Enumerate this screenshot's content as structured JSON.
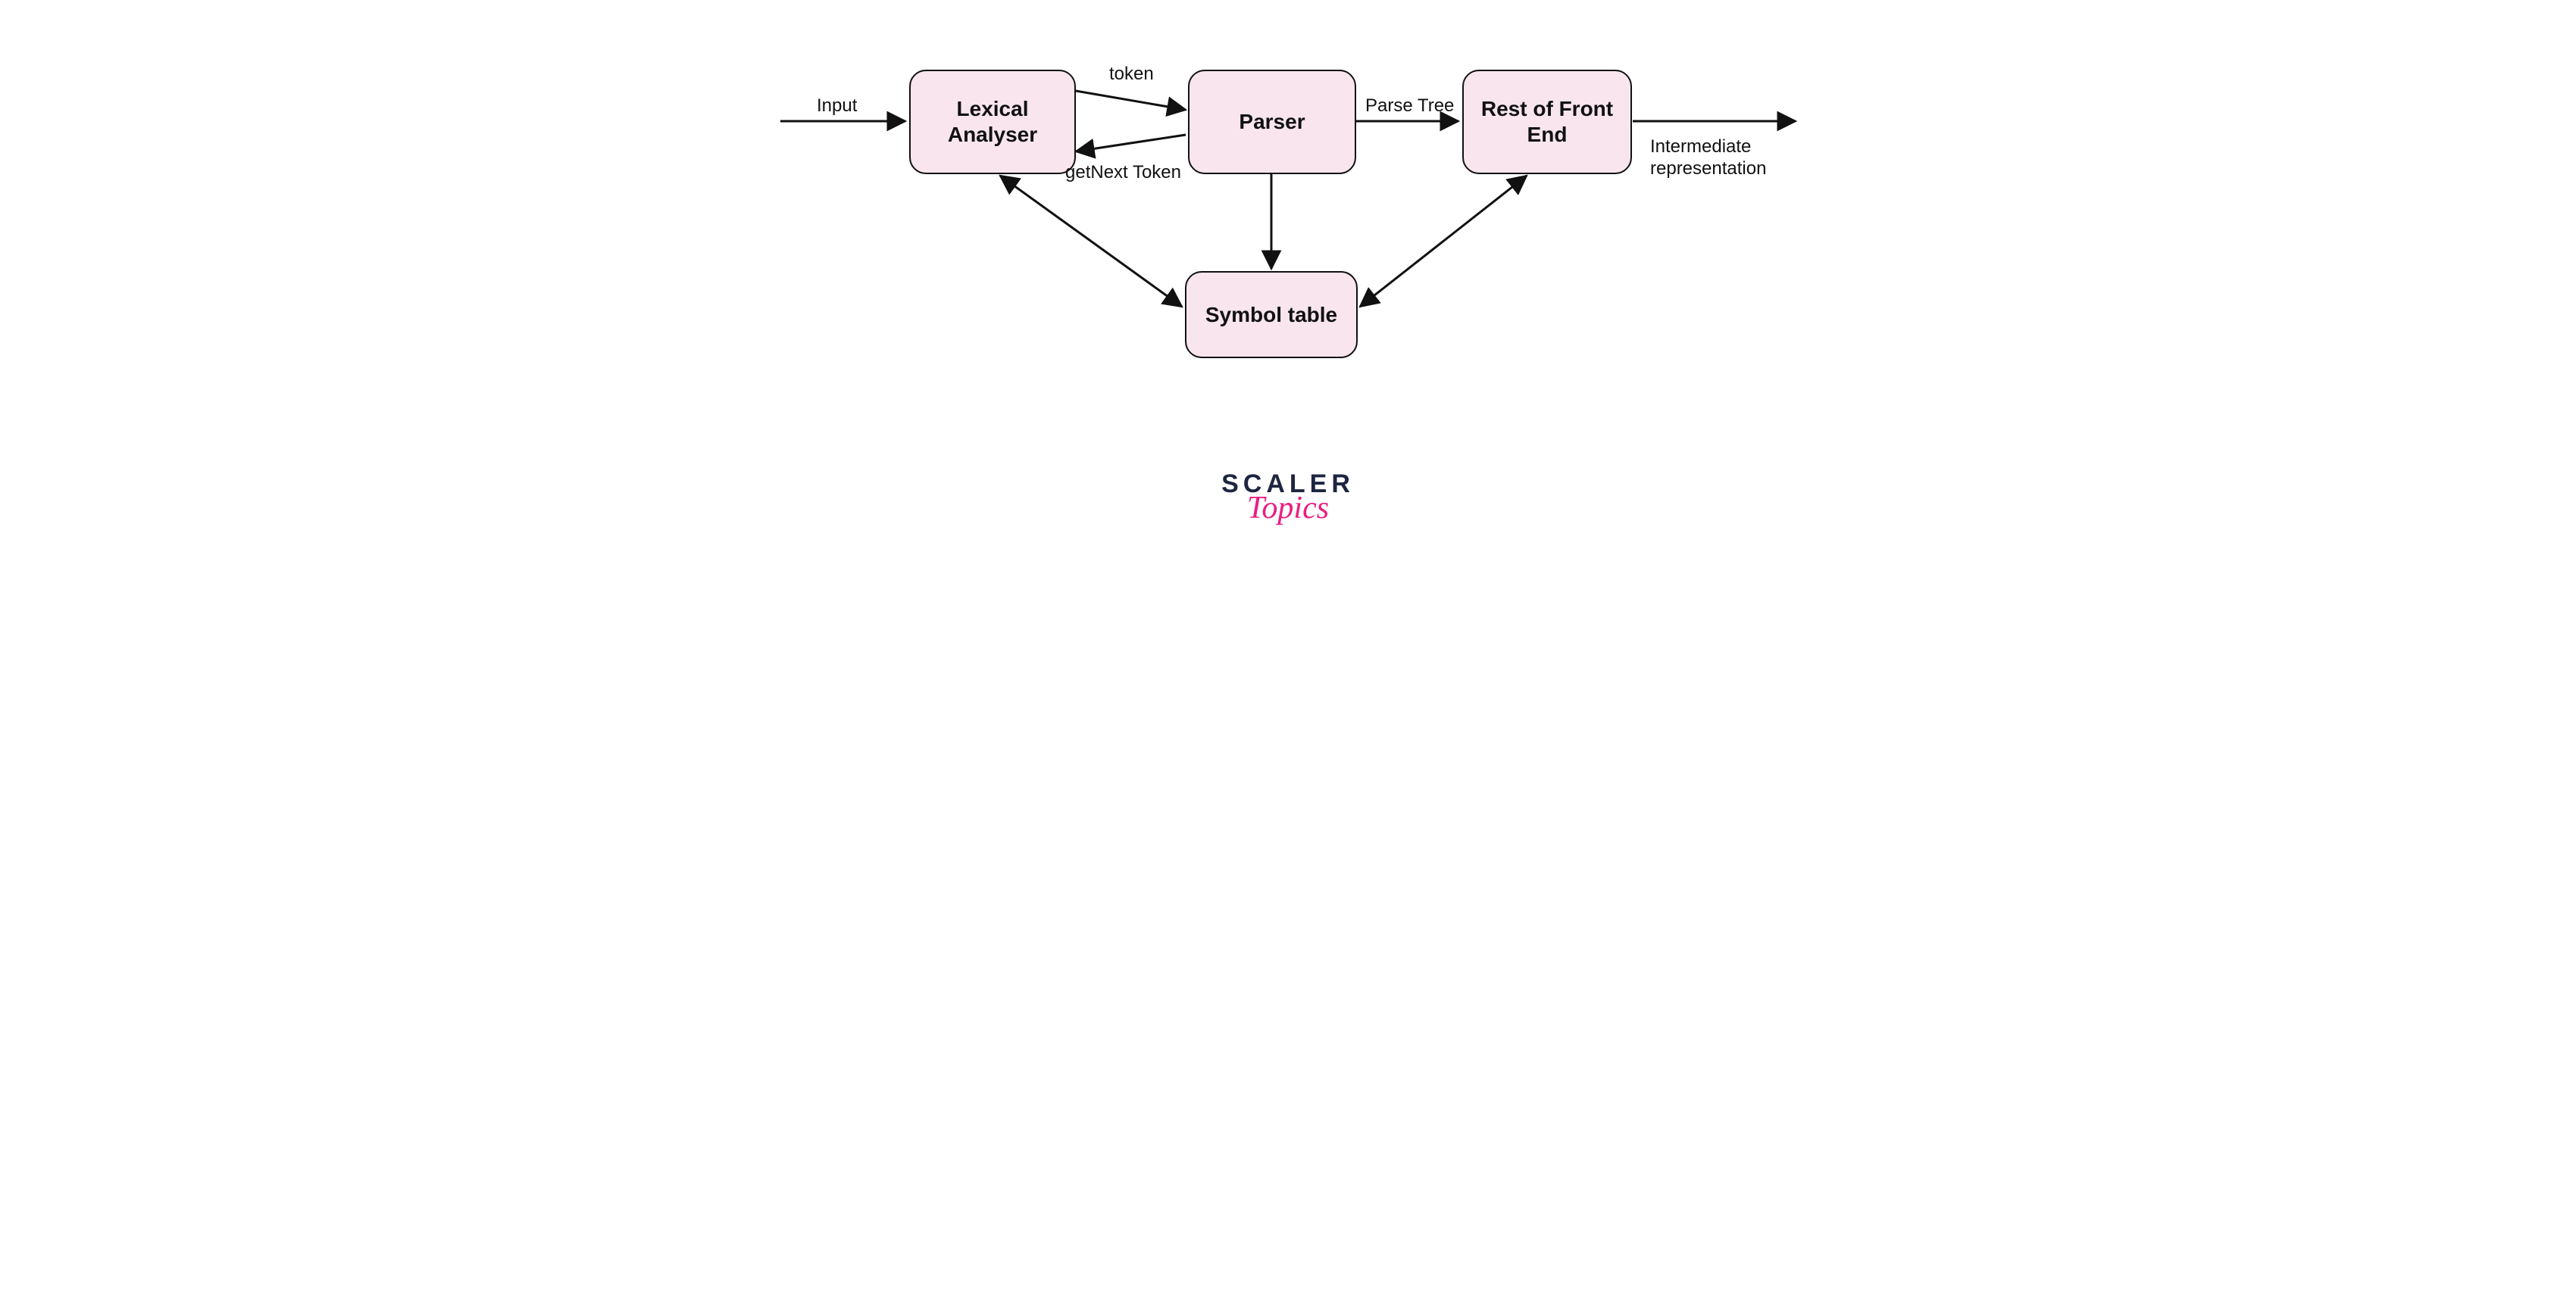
{
  "nodes": {
    "lexical": "Lexical Analyser",
    "parser": "Parser",
    "rest": "Rest of Front End",
    "symbol": "Symbol table"
  },
  "labels": {
    "input": "Input",
    "token": "token",
    "getNext": "getNext Token",
    "parseTree": "Parse Tree",
    "intermediate": "Intermediate representation"
  },
  "logo": {
    "line1": "SCALER",
    "line2": "Topics"
  },
  "colors": {
    "nodeFill": "#f8e5ee",
    "edge": "#111111",
    "logoDark": "#1d2540",
    "logoAccent": "#e91e82"
  }
}
